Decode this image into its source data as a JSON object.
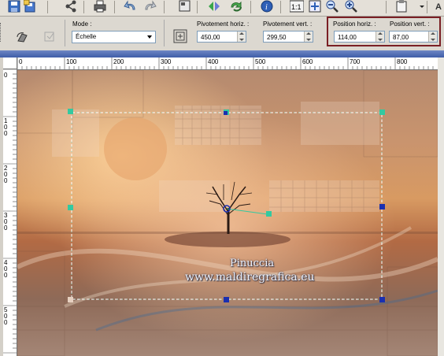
{
  "toolbar": {
    "icons": [
      "save-icon",
      "save-as-icon",
      "share-icon",
      "print-icon",
      "undo-icon",
      "redo-icon",
      "copy-icon",
      "flip-icon",
      "info-icon",
      "actual-size-icon",
      "fit-window-icon",
      "zoom-out-icon",
      "zoom-in-icon",
      "paste-icon",
      "menu-arrow-icon"
    ],
    "trailing_label": "A"
  },
  "options": {
    "mode_label": "Mode :",
    "mode_value": "Échelle",
    "pivot_h_label": "Pivotement horiz. :",
    "pivot_h_value": "450,00",
    "pivot_v_label": "Pivotement vert. :",
    "pivot_v_value": "299,50",
    "pos_h_label": "Position horiz. :",
    "pos_h_value": "114,00",
    "pos_v_label": "Position vert. :",
    "pos_v_value": "87,00",
    "highlight_color": "#7a1f24"
  },
  "ruler": {
    "h_ticks": [
      "0",
      "100",
      "200",
      "300",
      "400",
      "500",
      "600",
      "700",
      "800"
    ],
    "v_ticks": [
      "0",
      "100",
      "200",
      "300",
      "400",
      "500"
    ]
  },
  "watermark": {
    "line1": "Pinuccia",
    "line2": "www.maldiregrafica.eu"
  },
  "colors": {
    "selection_handle": "#33c9a0",
    "pivot_handle": "#1a2fb0",
    "window_title": "#3f5ea8"
  }
}
